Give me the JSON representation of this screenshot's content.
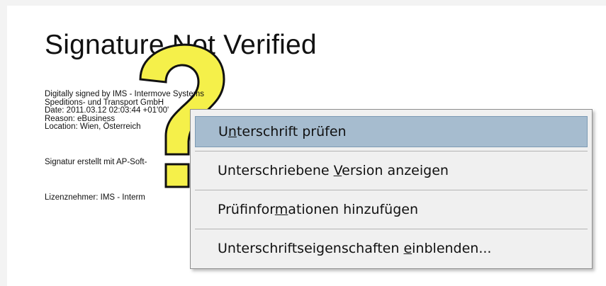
{
  "document": {
    "title": "Signature Not Verified",
    "signature_lines": [
      "Digitally signed by IMS - Intermove Systems",
      "Speditions- und Transport GmbH",
      "Date: 2011.03.12 02:03:44 +01'00'",
      "Reason: eBusiness",
      "Location: Wien, Österreich"
    ],
    "created_with": "Signatur erstellt mit AP-Soft-",
    "licensee": "Lizenznehmer: IMS - Interm"
  },
  "status_icon": "question-mark-icon",
  "context_menu": {
    "items": [
      {
        "before": "U",
        "key": "n",
        "after": "terschrift prüfen",
        "highlighted": true
      },
      {
        "before": "Unterschriebene ",
        "key": "V",
        "after": "ersion anzeigen",
        "highlighted": false
      },
      {
        "before": "Prüfinfor",
        "key": "m",
        "after": "ationen hinzufügen",
        "highlighted": false
      },
      {
        "before": "Unterschriftseigenschaften ",
        "key": "e",
        "after": "inblenden...",
        "highlighted": false
      }
    ]
  },
  "colors": {
    "highlight": "#a6bccf",
    "question_mark": "#f5f04a"
  }
}
